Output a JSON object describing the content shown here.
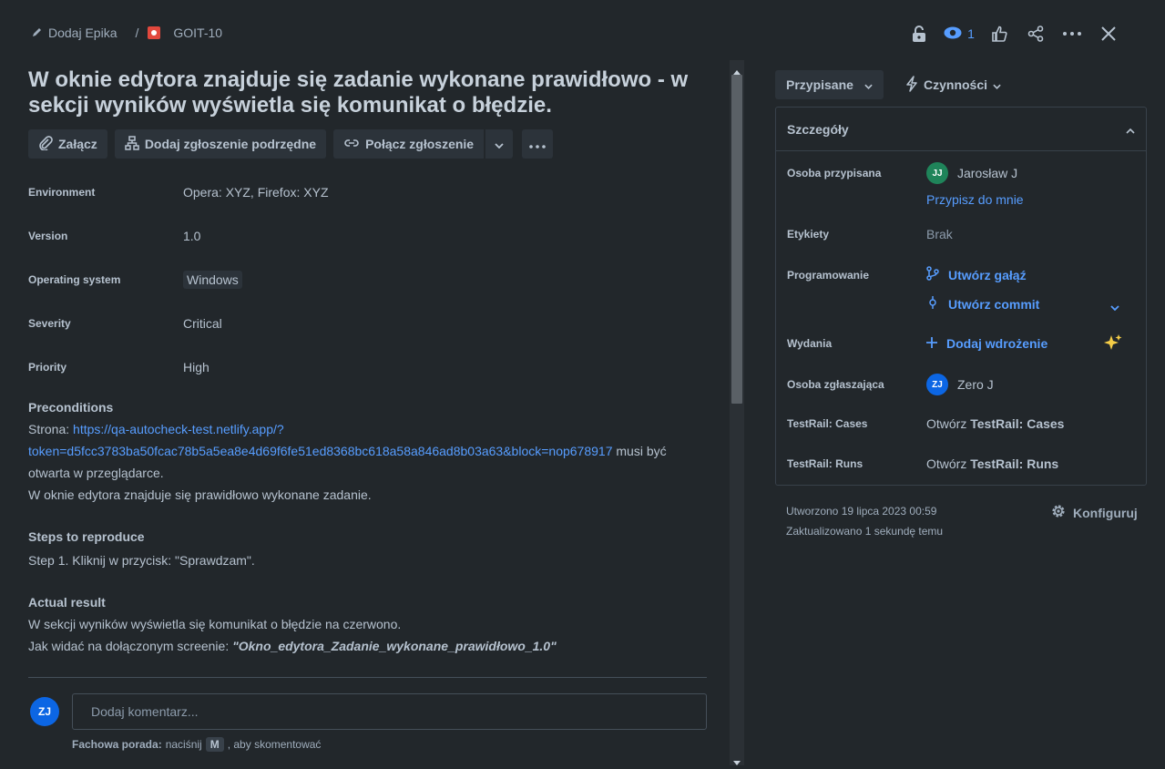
{
  "breadcrumb": {
    "epic": "Dodaj Epika",
    "separator": "/",
    "issue_key": "GOIT-10"
  },
  "topbar": {
    "watch_count": "1"
  },
  "issue": {
    "title": "W oknie edytora znajduje się zadanie wykonane prawidłowo - w sekcji wyników wyświetla się komunikat o błędzie.",
    "toolbar": {
      "attach": "Załącz",
      "add_child": "Dodaj zgłoszenie podrzędne",
      "link_issue": "Połącz zgłoszenie"
    },
    "fields": [
      {
        "label": "Environment",
        "value": "Opera: XYZ, Firefox: XYZ"
      },
      {
        "label": "Version",
        "value": "1.0"
      },
      {
        "label": "Operating system",
        "value": "Windows"
      },
      {
        "label": "Severity",
        "value": "Critical"
      },
      {
        "label": "Priority",
        "value": "High"
      }
    ],
    "preconditions": {
      "heading": "Preconditions",
      "prefix": "Strona: ",
      "link_line1": "https://qa-autocheck-test.netlify.app/?",
      "link_line2": "token=d5fcc3783ba50fcac78b5a5ea8e4d69f6fe51ed8368bc618a58a846ad8b03a63&block=nop678917",
      "suffix": " musi być",
      "line3": "otwarta w przeglądarce.",
      "line4": "W oknie edytora znajduje się prawidłowo wykonane zadanie."
    },
    "steps": {
      "heading": "Steps to reproduce",
      "text": "Step 1. Kliknij w przycisk: \"Sprawdzam\"."
    },
    "actual": {
      "heading": "Actual result",
      "line1": "W sekcji wyników wyświetla się komunikat o błędzie na czerwono.",
      "line2_prefix": "Jak widać na dołączonym screenie: ",
      "line2_bold": "\"Okno_edytora_Zadanie_wykonane_prawidłowo_1.0\""
    }
  },
  "comment": {
    "avatar": "ZJ",
    "placeholder": "Dodaj komentarz...",
    "tip_bold": "Fachowa porada:",
    "tip_text": " naciśnij ",
    "tip_key": "M",
    "tip_end": ", aby skomentować"
  },
  "sidebar": {
    "status_button": "Przypisane",
    "actions_button": "Czynności",
    "details_title": "Szczegóły",
    "assignee_label": "Osoba przypisana",
    "assignee_initials": "JJ",
    "assignee_name": "Jarosław J",
    "assign_me": "Przypisz do mnie",
    "labels_label": "Etykiety",
    "labels_value": "Brak",
    "dev_label": "Programowanie",
    "create_branch": "Utwórz gałąź",
    "create_commit": "Utwórz commit",
    "releases_label": "Wydania",
    "add_deployment": "Dodaj wdrożenie",
    "reporter_label": "Osoba zgłaszająca",
    "reporter_initials": "ZJ",
    "reporter_name": "Zero J",
    "tr_cases_label": "TestRail: Cases",
    "tr_cases_prefix": "Otwórz ",
    "tr_cases_bold": "TestRail: Cases",
    "tr_runs_label": "TestRail: Runs",
    "tr_runs_prefix": "Otwórz ",
    "tr_runs_bold": "TestRail: Runs",
    "created": "Utworzono 19 lipca 2023 00:59",
    "updated": "Zaktualizowano 1 sekundę temu",
    "configure": "Konfiguruj"
  },
  "colors": {
    "accent": "#579dff",
    "bg": "#22272b",
    "jj_avatar": "#1f845a",
    "zj_avatar": "#0c66e4",
    "issue_type_red": "#e2483d",
    "sparkle": "#f5cd47"
  },
  "icons": [
    "pencil-icon",
    "bug-icon",
    "lock-icon",
    "eye-icon",
    "thumbs-up-icon",
    "share-icon",
    "more-icon",
    "close-icon",
    "attachment-icon",
    "child-issue-icon",
    "link-icon",
    "chevron-down-icon",
    "branch-icon",
    "commit-icon",
    "plus-icon",
    "sparkle-icon",
    "gear-icon",
    "lightning-icon",
    "chevron-up-icon"
  ]
}
